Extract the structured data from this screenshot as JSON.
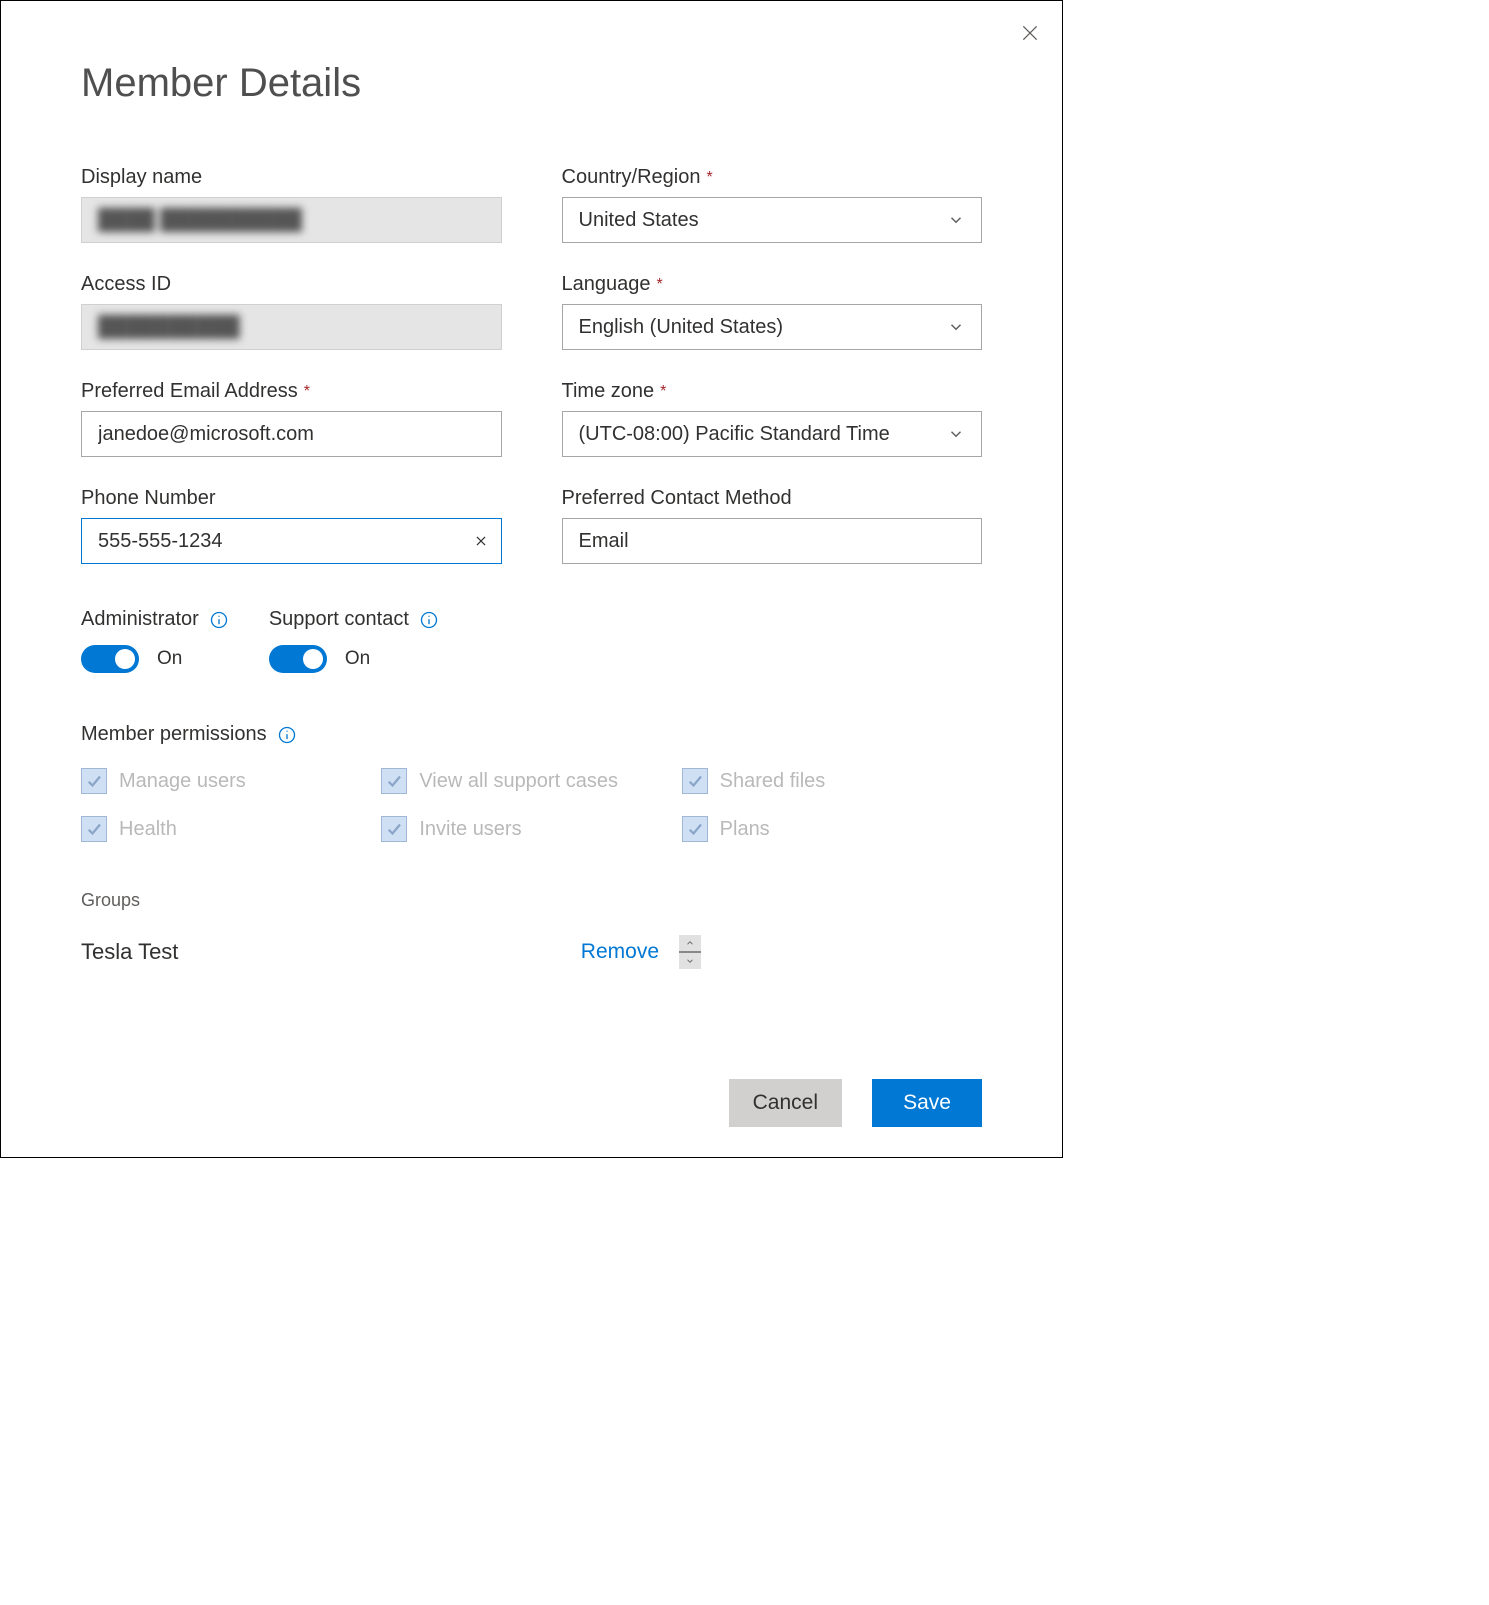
{
  "dialog": {
    "title": "Member Details",
    "fields": {
      "display_name": {
        "label": "Display name",
        "value": "████ ██████████"
      },
      "access_id": {
        "label": "Access ID",
        "value": "██████████"
      },
      "email": {
        "label": "Preferred Email Address",
        "value": "janedoe@microsoft.com",
        "required": true
      },
      "phone": {
        "label": "Phone Number",
        "value": "555-555-1234"
      },
      "country": {
        "label": "Country/Region",
        "value": "United States",
        "required": true
      },
      "language": {
        "label": "Language",
        "value": "English (United States)",
        "required": true
      },
      "timezone": {
        "label": "Time zone",
        "value": "(UTC-08:00) Pacific Standard Time",
        "required": true
      },
      "contact_method": {
        "label": "Preferred Contact Method",
        "value": "Email"
      }
    },
    "toggles": {
      "administrator": {
        "label": "Administrator",
        "state": "On"
      },
      "support_contact": {
        "label": "Support contact",
        "state": "On"
      }
    },
    "permissions": {
      "label": "Member permissions",
      "items": [
        "Manage users",
        "View all support cases",
        "Shared files",
        "Health",
        "Invite users",
        "Plans"
      ]
    },
    "groups": {
      "label": "Groups",
      "row": {
        "name": "Tesla Test",
        "remove": "Remove"
      }
    },
    "buttons": {
      "cancel": "Cancel",
      "save": "Save"
    }
  },
  "required_marker": "*"
}
